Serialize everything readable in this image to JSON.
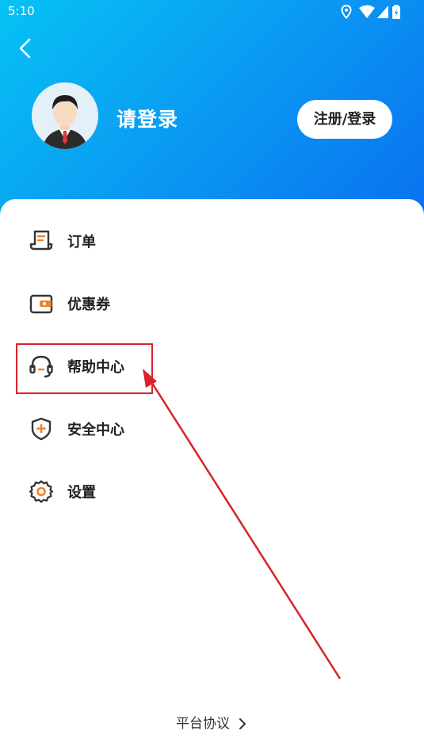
{
  "status_bar": {
    "time": "5:10",
    "icons": [
      "location-icon",
      "wifi-icon",
      "signal-icon",
      "battery-icon"
    ]
  },
  "header": {
    "back_icon": "chevron-left-icon",
    "avatar_icon": "user-avatar-icon",
    "login_prompt": "请登录",
    "register_label": "注册/登录"
  },
  "menu": {
    "items": [
      {
        "label": "订单",
        "icon": "order-document-icon"
      },
      {
        "label": "优惠券",
        "icon": "coupon-wallet-icon"
      },
      {
        "label": "帮助中心",
        "icon": "headset-icon"
      },
      {
        "label": "安全中心",
        "icon": "shield-icon"
      },
      {
        "label": "设置",
        "icon": "gear-icon"
      }
    ]
  },
  "footer": {
    "agreement_label": "平台协议"
  },
  "colors": {
    "header_gradient_start": "#06c2f4",
    "header_gradient_end": "#0a6ff0",
    "accent_orange": "#f0832a",
    "highlight_red": "#d8232a"
  }
}
